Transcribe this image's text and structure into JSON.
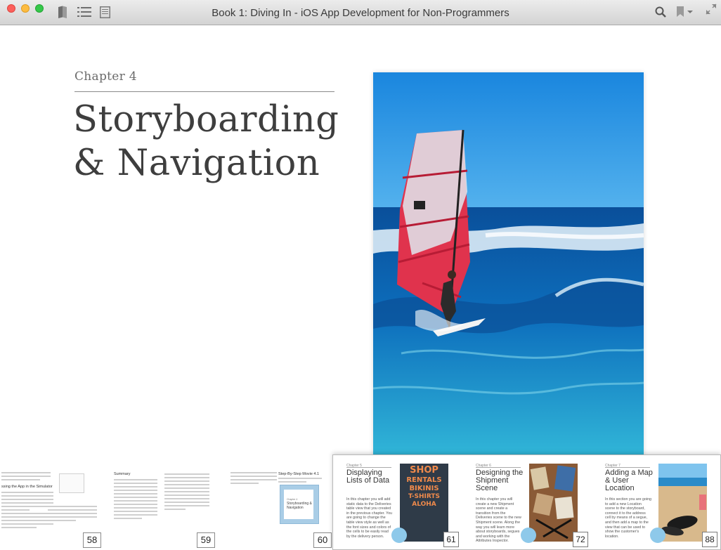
{
  "window": {
    "title": "Book 1: Diving In - iOS App Development for Non-Programmers",
    "icons": [
      "library-icon",
      "table-of-contents-icon",
      "notes-icon",
      "search-icon",
      "bookmark-icon",
      "fullscreen-icon"
    ]
  },
  "chapter": {
    "label": "Chapter 4",
    "title_line1": "Storyboarding",
    "title_line2": "& Navigation"
  },
  "thumbnails": {
    "pages": [
      {
        "number": "58",
        "heading": "ssing the App in the Simulator"
      },
      {
        "number": "59",
        "heading": "Summary"
      },
      {
        "number": "60",
        "heading": "Step-By-Step Movie 4.1",
        "slide_label": "Chapter 4",
        "slide_title": "Storyboarding & Navigation"
      }
    ]
  },
  "chapter_popup": {
    "cards": [
      {
        "number": "61",
        "label": "Chapter 5",
        "title": "Displaying Lists of Data",
        "text": "In this chapter you will add static data to the Deliveries table view that you created in the previous chapter. You are going to change the table view style as well as the font sizes and colors of the cells to be easily read by the delivery person.",
        "image": "shop-sign",
        "sign_words": [
          "SHOP",
          "RENTALS",
          "BIKINIS",
          "T-SHIRTS",
          "ALOHA"
        ]
      },
      {
        "number": "72",
        "label": "Chapter 6",
        "title": "Designing the Shipment Scene",
        "text": "In this chapter you will create a new Shipment scene and create a transition from the Deliveries scene to the new Shipment scene. Along the way you will learn more about storyboards, segues and working with the Attributes Inspector.",
        "image": "boxes-tags"
      },
      {
        "number": "88",
        "label": "Chapter 7",
        "title": "Adding a Map & User Location",
        "text": "In this section you are going to add a new Location scene to the storyboard, connect it to the address cell by means of a segue, and then add a map to the view that can be used to show the customer's location.",
        "image": "beach-sandals"
      }
    ]
  },
  "colors": {
    "sky": "#1f8ce0",
    "sea": "#0f6db4",
    "sail_red": "#e0334d",
    "popup_circle": "#8ec9ea"
  }
}
